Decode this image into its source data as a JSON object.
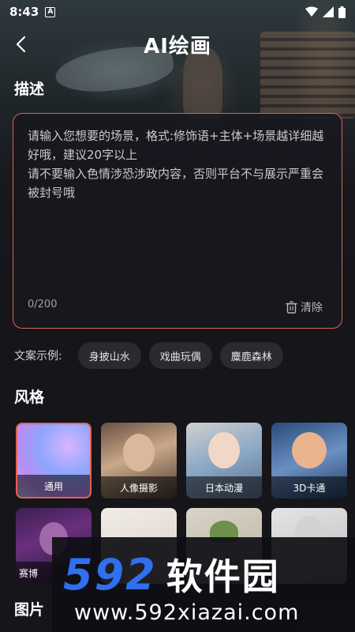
{
  "status_bar": {
    "time": "8:43",
    "notification_letter": "A"
  },
  "header": {
    "title": "AI绘画"
  },
  "description": {
    "section_label": "描述",
    "placeholder": "请输入您想要的场景，格式:修饰语+主体+场景越详细越好哦，建议20字以上\n请不要输入色情涉恐涉政内容，否则平台不与展示严重会被封号哦",
    "char_count": "0/200",
    "clear_label": "清除"
  },
  "examples": {
    "label": "文案示例:",
    "chips": [
      "身披山水",
      "戏曲玩偶",
      "麋鹿森林"
    ]
  },
  "style": {
    "section_label": "风格",
    "items": [
      {
        "label": "通用",
        "selected": true
      },
      {
        "label": "人像摄影",
        "selected": false
      },
      {
        "label": "日本动漫",
        "selected": false
      },
      {
        "label": "3D卡通",
        "selected": false
      },
      {
        "label": "赛博",
        "selected": false
      }
    ]
  },
  "bottom": {
    "label": "图片"
  },
  "watermark": {
    "logo_num": "592",
    "logo_cn": "软件园",
    "url": "www.592xiazai.com"
  },
  "colors": {
    "accent": "#e26155",
    "chip_bg": "#2a2a31",
    "page_bg": "#15151a",
    "watermark_blue": "#2f6ff0"
  }
}
